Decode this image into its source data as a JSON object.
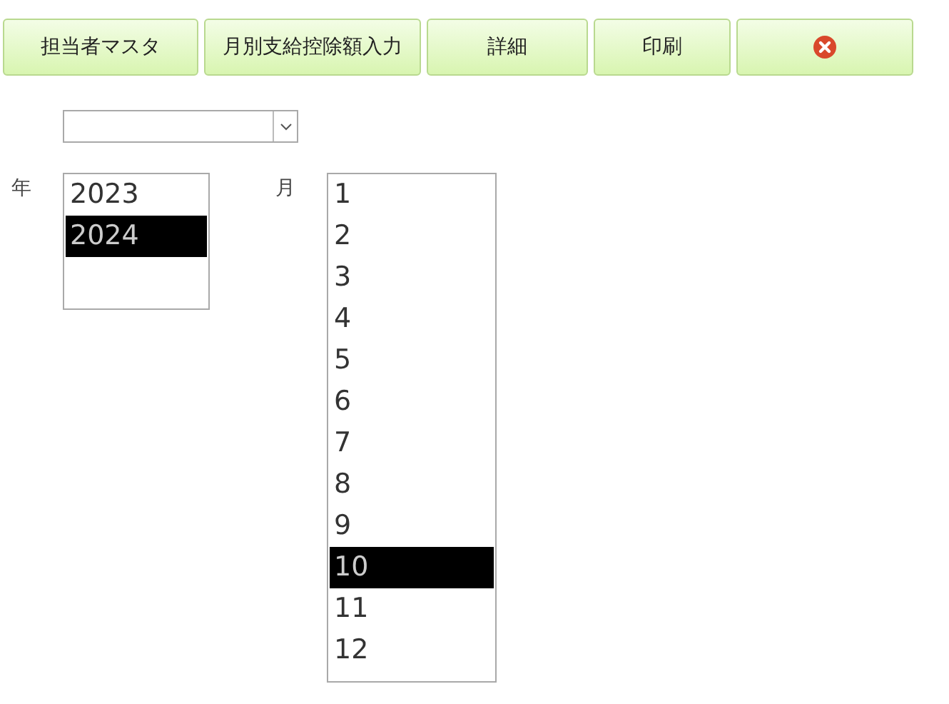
{
  "toolbar": [
    {
      "kind": "text",
      "label": "担当者マスタ"
    },
    {
      "kind": "text",
      "label": "月別支給控除額入力"
    },
    {
      "kind": "text",
      "label": "詳細"
    },
    {
      "kind": "text",
      "label": "印刷"
    },
    {
      "kind": "close"
    }
  ],
  "year": {
    "label": "年",
    "options": [
      {
        "label": "2023",
        "selected": false
      },
      {
        "label": "2024",
        "selected": true
      }
    ]
  },
  "month": {
    "label": "月",
    "options": [
      {
        "label": "1",
        "selected": false
      },
      {
        "label": "2",
        "selected": false
      },
      {
        "label": "3",
        "selected": false
      },
      {
        "label": "4",
        "selected": false
      },
      {
        "label": "5",
        "selected": false
      },
      {
        "label": "6",
        "selected": false
      },
      {
        "label": "7",
        "selected": false
      },
      {
        "label": "8",
        "selected": false
      },
      {
        "label": "9",
        "selected": false
      },
      {
        "label": "10",
        "selected": true
      },
      {
        "label": "11",
        "selected": false
      },
      {
        "label": "12",
        "selected": false
      }
    ]
  }
}
